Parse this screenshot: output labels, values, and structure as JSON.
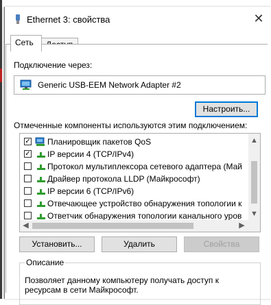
{
  "window": {
    "title": "Ethernet 3: свойства",
    "close_glyph": "✕"
  },
  "tabs": [
    {
      "label": "Сеть"
    },
    {
      "label": "Доступ"
    }
  ],
  "connection": {
    "label": "Подключение через:",
    "adapter": "Generic USB-EEM Network Adapter #2",
    "configure_button": "Настроить..."
  },
  "components": {
    "label": "Отмеченные компоненты используются этим подключением:",
    "items": [
      {
        "checked": true,
        "text": "Планировщик пакетов QoS",
        "icon": "qos-icon"
      },
      {
        "checked": true,
        "text": "IP версии 4 (TCP/IPv4)",
        "icon": "network-protocol-icon"
      },
      {
        "checked": false,
        "text": "Протокол мультиплексора сетевого адаптера (Май",
        "icon": "network-protocol-icon"
      },
      {
        "checked": false,
        "text": "Драйвер протокола LLDP (Майкрософт)",
        "icon": "network-protocol-icon"
      },
      {
        "checked": false,
        "text": "IP версии 6 (TCP/IPv6)",
        "icon": "network-protocol-icon"
      },
      {
        "checked": false,
        "text": "Отвечающее устройство обнаружения топологии к",
        "icon": "network-protocol-icon"
      },
      {
        "checked": false,
        "text": "Ответчик обнаружения топологии канального уров",
        "icon": "network-protocol-icon"
      }
    ]
  },
  "buttons": {
    "install": "Установить...",
    "remove": "Удалить",
    "properties": "Свойства"
  },
  "description": {
    "legend": "Описание",
    "text": "Позволяет данному компьютеру получать доступ к ресурсам в сети Майкрософт."
  },
  "colors": {
    "accent": "#0078d7",
    "protocol_green": "#2e9c2e",
    "monitor_blue": "#2a7fd0"
  }
}
